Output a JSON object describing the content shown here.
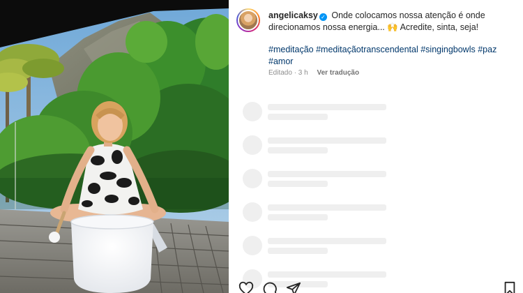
{
  "post": {
    "username": "angelicaksy",
    "caption_text": " Onde colocamos nossa atenção é onde direcionamos nossa energia... 🙌  Acredite, sinta, seja!",
    "hashtags": [
      "#meditação",
      "#meditaçãotranscendental",
      "#singingbowls",
      "#paz",
      "#amor"
    ],
    "edited_label": "Editado · 3 h",
    "translate_label": "Ver tradução"
  },
  "icons": {
    "verified": "verified-badge-icon",
    "like": "heart-icon",
    "comment": "comment-icon",
    "share": "send-icon",
    "save": "bookmark-icon"
  },
  "colors": {
    "hashtag": "#00376b",
    "verified": "#0095f6",
    "skeleton": "#efefef",
    "meta": "#8e8e8e"
  }
}
